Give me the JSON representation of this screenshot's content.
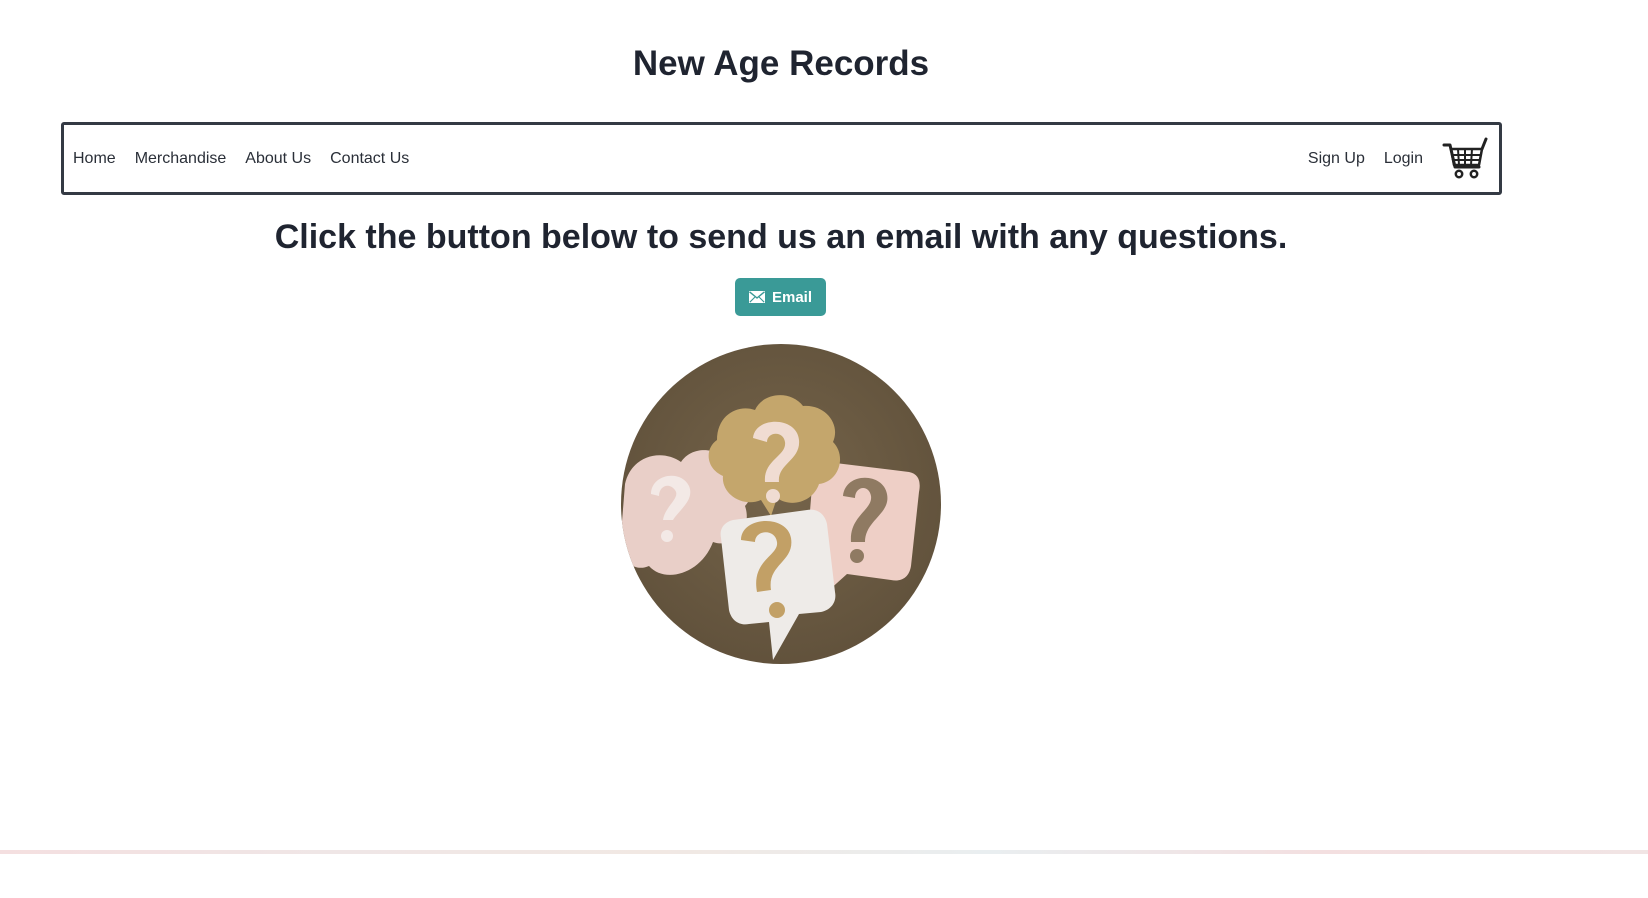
{
  "site": {
    "title": "New Age Records"
  },
  "nav": {
    "left_items": [
      {
        "label": "Home"
      },
      {
        "label": "Merchandise"
      },
      {
        "label": "About Us"
      },
      {
        "label": "Contact Us"
      }
    ],
    "right_items": [
      {
        "label": "Sign Up"
      },
      {
        "label": "Login"
      }
    ],
    "cart_icon": "shopping-cart-icon"
  },
  "main": {
    "heading": "Click the button below to send us an email with any questions.",
    "email_button": {
      "label": "Email",
      "icon": "envelope-icon"
    },
    "image": {
      "subject": "paper-cut speech bubbles with question marks"
    }
  },
  "colors": {
    "accent": "#3a9a97",
    "text": "#1f2430",
    "nav_border": "#343a44",
    "image_background": "#6b5a43"
  }
}
